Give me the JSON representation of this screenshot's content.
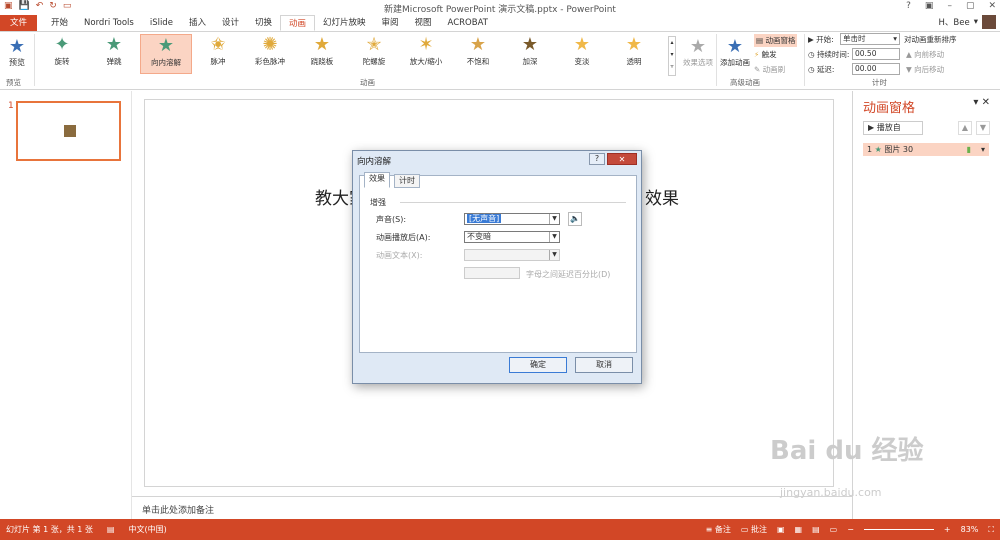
{
  "window": {
    "title": "新建Microsoft PowerPoint 演示文稿.pptx - PowerPoint",
    "user_name": "H、Bee",
    "help": "?"
  },
  "tabs": [
    "文件",
    "开始",
    "Nordri Tools",
    "iSlide",
    "插入",
    "设计",
    "切换",
    "动画",
    "幻灯片放映",
    "审阅",
    "视图",
    "ACROBAT"
  ],
  "active_tab": "动画",
  "ribbon": {
    "preview_label": "预览",
    "preview_group": "预览",
    "animation_group": "动画",
    "advanced_group": "高级动画",
    "timing_group": "计时",
    "effects": [
      "旋转",
      "弹跳",
      "向内溶解",
      "脉冲",
      "彩色脉冲",
      "跷跷板",
      "陀螺旋",
      "放大/缩小",
      "不饱和",
      "加深",
      "变淡",
      "透明"
    ],
    "selected_effect": "向内溶解",
    "effect_options": "效果选项",
    "add_animation": "添加动画",
    "animation_pane_btn": "动画窗格",
    "trigger": "触发",
    "animation_painter": "动画刷",
    "start_label": "开始:",
    "start_value": "单击时",
    "duration_label": "持续时间:",
    "duration_value": "00.50",
    "delay_label": "延迟:",
    "delay_value": "00.00",
    "reorder_label": "对动画重新排序",
    "move_earlier": "向前移动",
    "move_later": "向后移动"
  },
  "slides_panel": {
    "number": "1"
  },
  "slide": {
    "text_left": "教大家",
    "text_right": "效果"
  },
  "notes": "单击此处添加备注",
  "anim_pane": {
    "title": "动画窗格",
    "play_btn": "播放自",
    "item_number": "1",
    "item_label": "图片 30"
  },
  "dialog": {
    "title": "向内溶解",
    "tab_effect": "效果",
    "tab_timing": "计时",
    "section": "增强",
    "sound_label": "声音(S):",
    "sound_value": "[无声音]",
    "after_label": "动画播放后(A):",
    "after_value": "不变暗",
    "text_label": "动画文本(X):",
    "text_value": "",
    "pct_label": "字母之间延迟百分比(D)",
    "ok": "确定",
    "cancel": "取消"
  },
  "status": {
    "slide_info": "幻灯片 第 1 张，共 1 张",
    "language": "中文(中国)",
    "notes_btn": "备注",
    "comments_btn": "批注",
    "zoom": "83%"
  },
  "watermark": {
    "brand": "Bai du 经验",
    "url": "jingyan.baidu.com"
  }
}
